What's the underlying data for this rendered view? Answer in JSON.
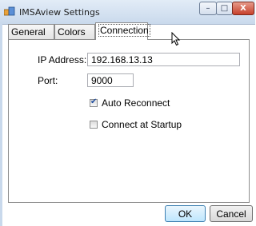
{
  "window": {
    "title": "IMSAview Settings",
    "controls": {
      "minimize": "–",
      "maximize": "□",
      "close": "X"
    }
  },
  "tabs": [
    {
      "label": "General",
      "active": false
    },
    {
      "label": "Colors",
      "active": false
    },
    {
      "label": "Connection",
      "active": true
    }
  ],
  "connection": {
    "ip_label": "IP Address:",
    "ip_value": "192.168.13.13",
    "port_label": "Port:",
    "port_value": "9000",
    "auto_reconnect": {
      "label": "Auto Reconnect",
      "checked": true
    },
    "connect_startup": {
      "label": "Connect at Startup",
      "checked": false
    }
  },
  "buttons": {
    "ok": "OK",
    "cancel": "Cancel"
  },
  "icons": {
    "app": "settings-app-icon",
    "cursor": "mouse-pointer-icon"
  }
}
